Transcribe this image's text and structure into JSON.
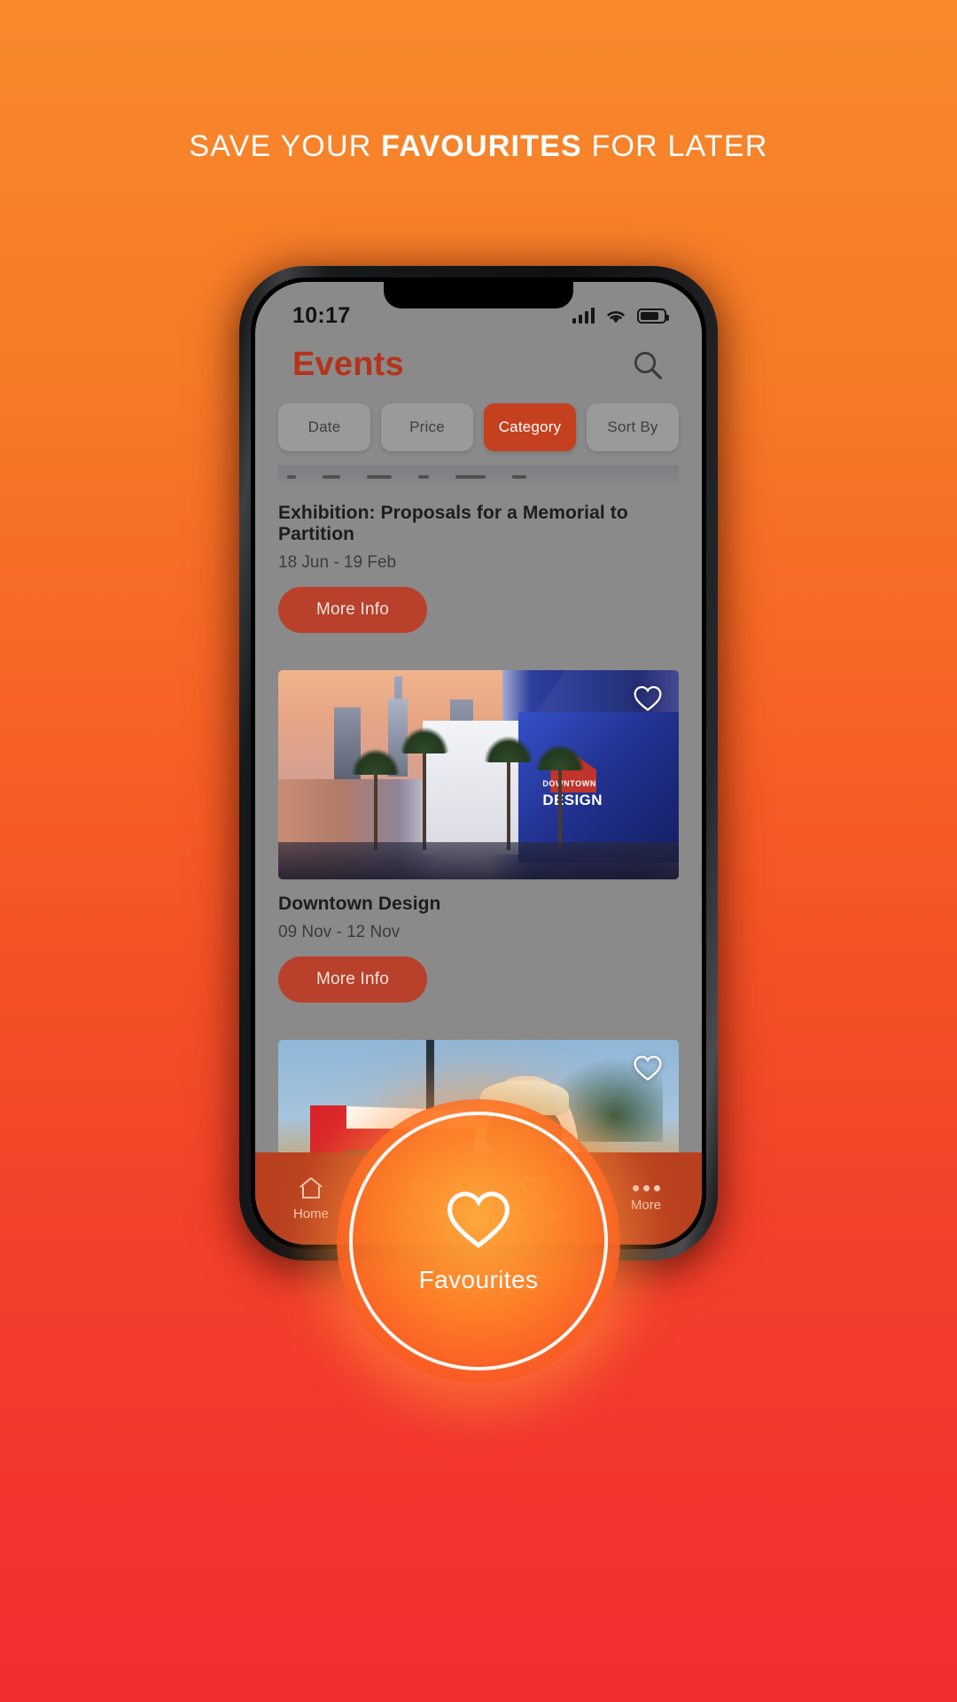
{
  "promo": {
    "headline_lead": "SAVE YOUR ",
    "headline_emphasis": "FAVOURITES",
    "headline_trail": " FOR LATER",
    "background_top": "#f7892c",
    "background_bottom": "#f22d32"
  },
  "status_bar": {
    "time": "10:17",
    "signal_icon": "cellular-bars-icon",
    "wifi_icon": "wifi-icon",
    "battery_icon": "battery-icon"
  },
  "app": {
    "title": "Events",
    "title_color": "#b5321c",
    "accent_color": "#c5401f",
    "search_icon": "search-icon"
  },
  "filters": [
    {
      "label": "Date",
      "active": false
    },
    {
      "label": "Price",
      "active": false
    },
    {
      "label": "Category",
      "active": true
    },
    {
      "label": "Sort By",
      "active": false
    }
  ],
  "events": [
    {
      "title": "Exhibition: Proposals for a Memorial to Partition",
      "dates": "18 Jun - 19 Feb",
      "cta": "More Info",
      "favourite_icon": "heart-outline-icon"
    },
    {
      "title": "Downtown Design",
      "dates": "09 Nov - 12 Nov",
      "cta": "More Info",
      "favourite_icon": "heart-outline-icon",
      "image_text_top": "DOWNTOWN",
      "image_text_bottom": "DESIGN"
    },
    {
      "title": "",
      "dates": "",
      "cta": "",
      "favourite_icon": "heart-outline-icon"
    }
  ],
  "tabbar": {
    "background": "#b8401f",
    "items": [
      {
        "label": "Home",
        "icon": "home-icon",
        "active": false
      },
      {
        "label": "Discover",
        "icon": "globe-icon",
        "active": false
      },
      {
        "label": "Favourites",
        "icon": "heart-icon",
        "active": true
      },
      {
        "label": "More",
        "icon": "more-dots-icon",
        "active": false
      }
    ]
  },
  "spotlight": {
    "label": "Favourites",
    "icon": "heart-outline-icon"
  }
}
